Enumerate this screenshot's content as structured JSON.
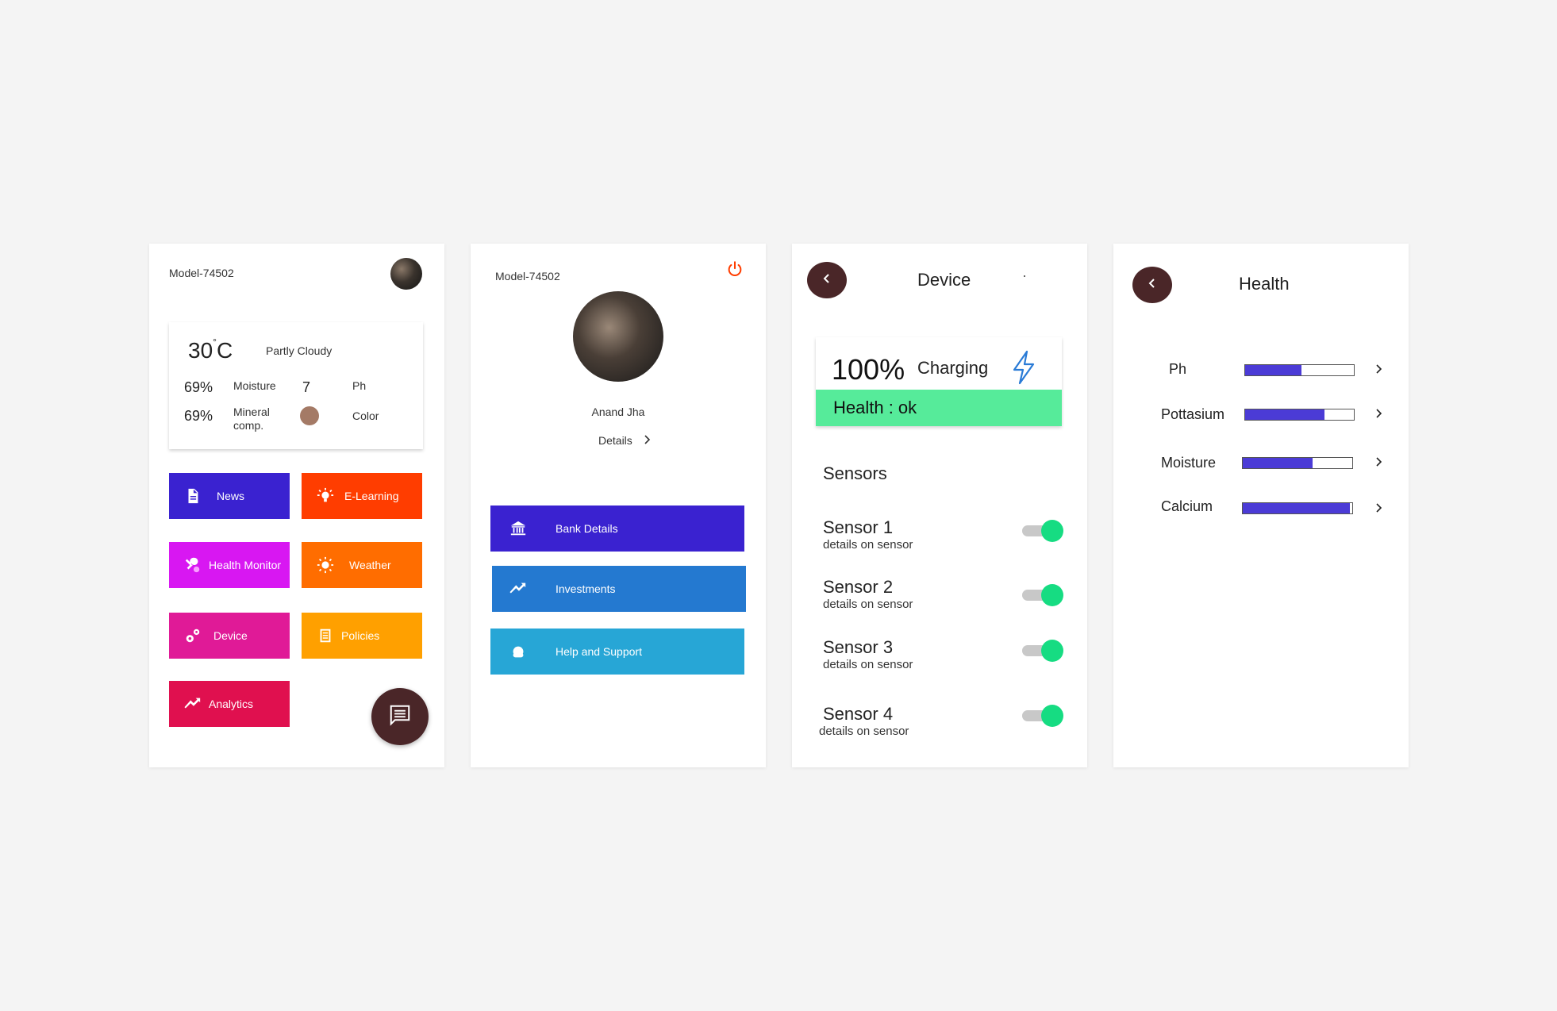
{
  "home": {
    "model": "Model-74502",
    "weather": {
      "temp": "30",
      "deg_symbol": "°",
      "unit": "C",
      "condition": "Partly Cloudy",
      "moisture_value": "69%",
      "moisture_label": "Moisture",
      "ph_value": "7",
      "ph_label": "Ph",
      "mineral_value": "69%",
      "mineral_label_1": "Mineral",
      "mineral_label_2": "comp.",
      "color_label": "Color",
      "color_swatch": "#a47a66"
    },
    "tiles": [
      {
        "label": "News",
        "color": "#3a22d0",
        "icon": "document-icon"
      },
      {
        "label": "E-Learning",
        "color": "#ff3d00",
        "icon": "lightbulb-icon"
      },
      {
        "label": "Health Monitor",
        "color": "#d817f2",
        "icon": "wrench-icon"
      },
      {
        "label": "Weather",
        "color": "#ff6d00",
        "icon": "sun-icon"
      },
      {
        "label": "Device",
        "color": "#e01a97",
        "icon": "gears-icon"
      },
      {
        "label": "Policies",
        "color": "#ffa000",
        "icon": "list-icon"
      },
      {
        "label": "Analytics",
        "color": "#e0104f",
        "icon": "trending-icon"
      }
    ],
    "fab_icon": "chat-icon"
  },
  "profile": {
    "model": "Model-74502",
    "power_color": "#ff3d00",
    "name": "Anand Jha",
    "details_label": "Details",
    "buttons": [
      {
        "label": "Bank Details",
        "color": "#3a22d0",
        "icon": "bank-icon"
      },
      {
        "label": "Investments",
        "color": "#2479d0",
        "icon": "trending-icon"
      },
      {
        "label": "Help and Support",
        "color": "#27a6d6",
        "icon": "support-icon"
      }
    ]
  },
  "device": {
    "title": "Device",
    "battery_percent": "100%",
    "battery_status": "Charging",
    "health_text": "Health  : ok",
    "sensors_heading": "Sensors",
    "sensors": [
      {
        "name": "Sensor 1",
        "sub": "details on sensor",
        "enabled": true
      },
      {
        "name": "Sensor 2",
        "sub": "details on sensor",
        "enabled": true
      },
      {
        "name": "Sensor 3",
        "sub": "details on sensor",
        "enabled": true
      },
      {
        "name": "Sensor 4",
        "sub": "details on sensor",
        "enabled": true
      }
    ],
    "accent": "#16dc82"
  },
  "health": {
    "title": "Health",
    "metrics": [
      {
        "label": "Ph",
        "level": 0.52
      },
      {
        "label": "Pottasium",
        "level": 0.73
      },
      {
        "label": "Moisture",
        "level": 0.64
      },
      {
        "label": "Calcium",
        "level": 0.98
      }
    ],
    "bar_color": "#4b3bd6"
  }
}
